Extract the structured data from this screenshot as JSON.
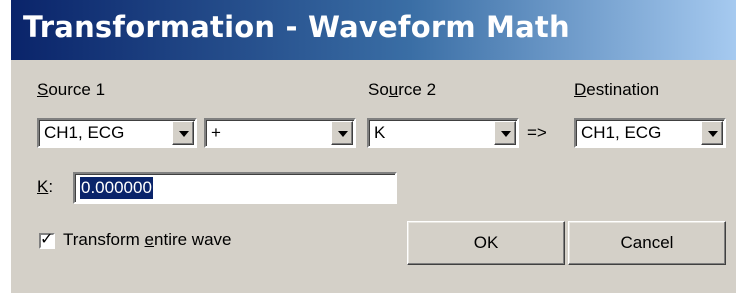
{
  "window": {
    "title": "Transformation - Waveform Math"
  },
  "labels": {
    "source1": {
      "prefix": "",
      "mnemonic": "S",
      "rest": "ource 1"
    },
    "source2": {
      "prefix": "So",
      "mnemonic": "u",
      "rest": "rce 2"
    },
    "destination": {
      "prefix": "",
      "mnemonic": "D",
      "rest": "estination"
    },
    "k": {
      "mnemonic": "K",
      "rest": ":"
    },
    "arrow": "=>"
  },
  "selects": {
    "source1": "CH1, ECG",
    "operator": "+",
    "source2": "K",
    "destination": "CH1, ECG"
  },
  "k_field": {
    "value": "0.000000"
  },
  "checkbox": {
    "checked": true,
    "check_glyph": "✓",
    "label_prefix": "Transform ",
    "label_mnemonic": "e",
    "label_rest": "ntire wave"
  },
  "buttons": {
    "ok": "OK",
    "cancel": "Cancel"
  }
}
